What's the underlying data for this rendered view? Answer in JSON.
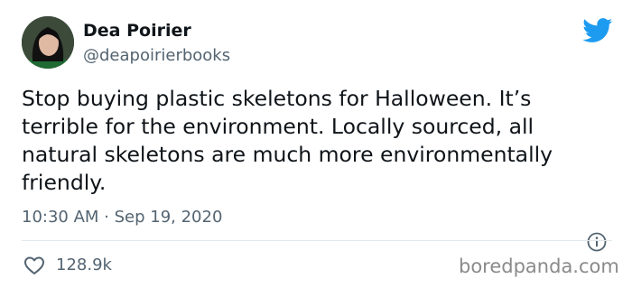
{
  "author": {
    "name": "Dea Poirier",
    "handle": "@deapoirierbooks"
  },
  "tweet": {
    "lines": [
      "Stop buying plastic skeletons for Halloween. It’s",
      "terrible for the environment. Locally sourced, all",
      "natural skeletons are much more environmentally",
      "friendly."
    ],
    "timestamp": "10:30 AM · Sep 19, 2020",
    "likes": "128.9k"
  },
  "icons": {
    "brand": "twitter-bird-icon",
    "info": "info-icon",
    "like": "heart-icon"
  },
  "colors": {
    "twitter_blue": "#1d9bf0",
    "muted_text": "#536471",
    "primary_text": "#0f1419",
    "divider": "#e1e8ed"
  },
  "watermark": "boredpanda.com"
}
